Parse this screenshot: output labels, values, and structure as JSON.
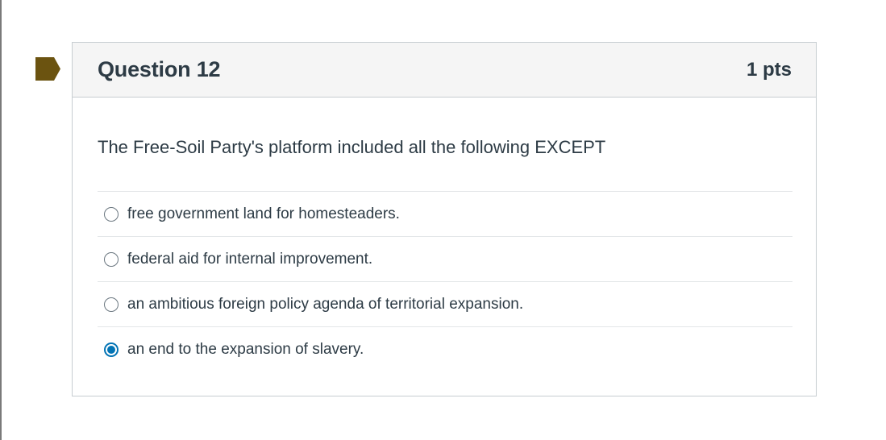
{
  "question": {
    "title": "Question 12",
    "points": "1 pts",
    "text": "The Free-Soil Party's platform included all the following EXCEPT",
    "answers": [
      {
        "label": "free government land for homesteaders.",
        "selected": false
      },
      {
        "label": "federal aid for internal improvement.",
        "selected": false
      },
      {
        "label": "an ambitious foreign policy agenda of territorial expansion.",
        "selected": false
      },
      {
        "label": "an end to the expansion of slavery.",
        "selected": true
      }
    ]
  },
  "colors": {
    "flag": "#6b5310",
    "accent": "#0374b5",
    "text": "#2d3b45",
    "header_bg": "#f5f5f5",
    "border": "#c7cdd1"
  },
  "icons": {
    "flag": "bookmark-flag-icon"
  }
}
